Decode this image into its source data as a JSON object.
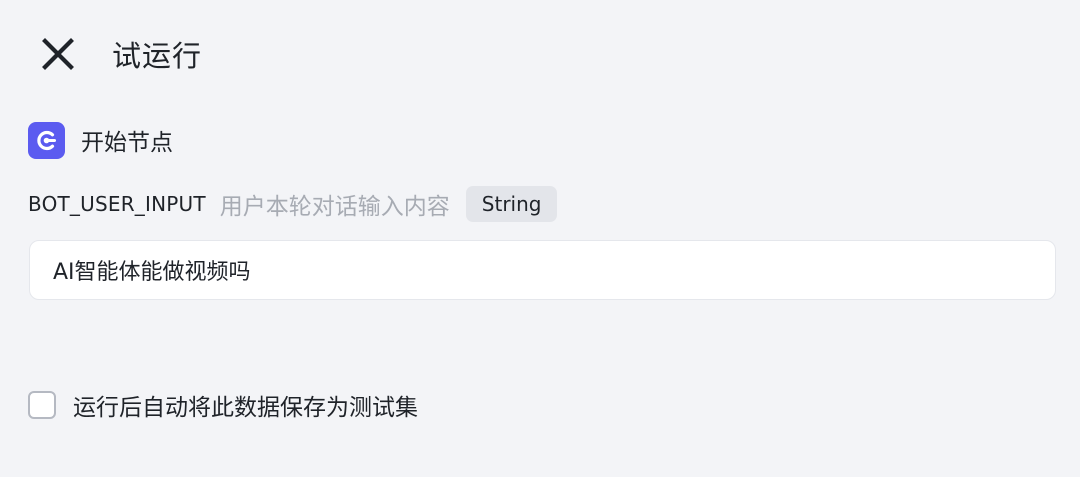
{
  "header": {
    "title": "试运行",
    "close_icon": "close-icon"
  },
  "node": {
    "label": "开始节点",
    "icon": "start-node-icon",
    "icon_color": "#5b5bf0"
  },
  "param": {
    "name": "BOT_USER_INPUT",
    "description": "用户本轮对话输入内容",
    "type": "String",
    "value": "AI智能体能做视频吗"
  },
  "save_option": {
    "label": "运行后自动将此数据保存为测试集",
    "checked": false
  }
}
